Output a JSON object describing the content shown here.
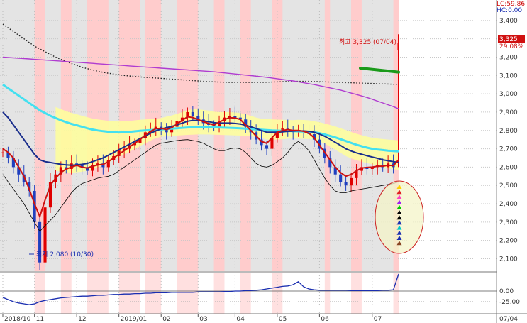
{
  "header": {
    "lc_label": "LC:59.86",
    "hc_label": "HC:0.00",
    "last_price": "3,325",
    "last_change": "29.08%"
  },
  "annotations": {
    "high": "최고 3,325 (07/04)",
    "low": "최저 2,080 (10/30)"
  },
  "colors": {
    "candle_up": "#e00000",
    "candle_down": "#1f3fbf",
    "ma_short": "#cc1111",
    "ma_mid": "#1a2e8c",
    "ma_cyan": "#44e0f0",
    "ma_black_dotted": "#222222",
    "ma_purple": "#b03cd0",
    "bollinger": "#000000",
    "cloud": "#ffff9a",
    "highlight_red": "#ffcccc",
    "shade_gray": "#e4e4e4",
    "indicator_line": "#1a2eb0",
    "ellipse": "#cc2222"
  },
  "chart_data": {
    "type": "line",
    "title": "",
    "xlabel": "",
    "ylabel": "",
    "ylim": [
      2040,
      3500
    ],
    "y_ticks": [
      "3,400",
      "3,300",
      "3,200",
      "3,100",
      "3,000",
      "2,900",
      "2,800",
      "2,700",
      "2,600",
      "2,500",
      "2,400",
      "2,300",
      "2,200",
      "2,100"
    ],
    "x_ticks": [
      "2018/10",
      "11",
      "12",
      "2019/01",
      "02",
      "03",
      "04",
      "05",
      "06",
      "07"
    ],
    "right_bottom_label": "07/04",
    "series": [
      {
        "name": "",
        "role": "close",
        "values": [
          2680,
          2650,
          2600,
          2560,
          2520,
          2470,
          2300,
          2080,
          2380,
          2520,
          2560,
          2600,
          2590,
          2620,
          2610,
          2600,
          2580,
          2610,
          2620,
          2600,
          2640,
          2660,
          2690,
          2700,
          2720,
          2730,
          2760,
          2790,
          2800,
          2820,
          2810,
          2790,
          2820,
          2850,
          2870,
          2900,
          2880,
          2860,
          2840,
          2830,
          2820,
          2850,
          2870,
          2880,
          2870,
          2860,
          2820,
          2790,
          2750,
          2720,
          2700,
          2760,
          2800,
          2810,
          2800,
          2790,
          2800,
          2790,
          2780,
          2750,
          2700,
          2650,
          2600,
          2560,
          2520,
          2500,
          2540,
          2580,
          2600,
          2590,
          2600,
          2610,
          2600,
          2620,
          2600,
          3325
        ]
      },
      {
        "name": "",
        "role": "ma_short",
        "values": [
          2700,
          2680,
          2650,
          2600,
          2550,
          2480,
          2400,
          2330,
          2420,
          2500,
          2540,
          2570,
          2590,
          2600,
          2610,
          2600,
          2595,
          2605,
          2612,
          2615,
          2630,
          2650,
          2670,
          2690,
          2710,
          2730,
          2750,
          2775,
          2795,
          2810,
          2812,
          2805,
          2815,
          2835,
          2855,
          2875,
          2870,
          2860,
          2848,
          2838,
          2830,
          2845,
          2860,
          2870,
          2868,
          2860,
          2830,
          2800,
          2770,
          2740,
          2730,
          2760,
          2790,
          2800,
          2805,
          2800,
          2800,
          2795,
          2785,
          2760,
          2720,
          2680,
          2640,
          2600,
          2570,
          2550,
          2560,
          2580,
          2595,
          2598,
          2600,
          2605,
          2605,
          2610,
          2608,
          2640
        ]
      },
      {
        "name": "",
        "role": "ma_mid",
        "values": [
          2900,
          2870,
          2830,
          2790,
          2750,
          2710,
          2670,
          2640,
          2630,
          2625,
          2620,
          2615,
          2612,
          2610,
          2612,
          2615,
          2620,
          2630,
          2640,
          2650,
          2665,
          2680,
          2695,
          2710,
          2725,
          2740,
          2755,
          2770,
          2785,
          2798,
          2808,
          2815,
          2822,
          2830,
          2840,
          2850,
          2855,
          2855,
          2852,
          2848,
          2842,
          2840,
          2840,
          2840,
          2838,
          2835,
          2828,
          2820,
          2810,
          2800,
          2790,
          2790,
          2790,
          2792,
          2795,
          2796,
          2798,
          2797,
          2795,
          2790,
          2780,
          2768,
          2752,
          2735,
          2718,
          2700,
          2688,
          2678,
          2670,
          2662,
          2655,
          2648,
          2640,
          2635,
          2630,
          2625
        ]
      },
      {
        "name": "",
        "role": "ma_cyan",
        "values": [
          3050,
          3030,
          3010,
          2990,
          2970,
          2950,
          2930,
          2910,
          2895,
          2880,
          2868,
          2856,
          2845,
          2836,
          2828,
          2820,
          2812,
          2805,
          2800,
          2796,
          2793,
          2790,
          2789,
          2790,
          2792,
          2795,
          2798,
          2800,
          2802,
          2804,
          2806,
          2808,
          2810,
          2812,
          2814,
          2816,
          2817,
          2818,
          2818,
          2818,
          2817,
          2816,
          2815,
          2814,
          2813,
          2812,
          2810,
          2808,
          2806,
          2804,
          2802,
          2800,
          2799,
          2798,
          2797,
          2796,
          2795,
          2794,
          2793,
          2790,
          2785,
          2778,
          2770,
          2762,
          2752,
          2742,
          2732,
          2722,
          2714,
          2706,
          2700,
          2696,
          2693,
          2690,
          2688,
          2686
        ]
      },
      {
        "name": "",
        "role": "ma_black_dotted",
        "values": [
          3380,
          3360,
          3340,
          3320,
          3300,
          3280,
          3260,
          3245,
          3230,
          3215,
          3200,
          3188,
          3176,
          3165,
          3155,
          3145,
          3137,
          3130,
          3123,
          3117,
          3112,
          3108,
          3104,
          3100,
          3097,
          3094,
          3092,
          3090,
          3088,
          3086,
          3084,
          3082,
          3080,
          3078,
          3076,
          3074,
          3072,
          3070,
          3068,
          3066,
          3065,
          3064,
          3063,
          3062,
          3062,
          3062,
          3062,
          3062,
          3062,
          3062,
          3063,
          3064,
          3065,
          3066,
          3067,
          3068,
          3068,
          3068,
          3068,
          3067,
          3066,
          3065,
          3064,
          3063,
          3062,
          3061,
          3060,
          3059,
          3058,
          3057,
          3056,
          3055,
          3054,
          3053,
          3052,
          3051
        ]
      },
      {
        "name": "",
        "role": "ma_purple",
        "values": [
          3200,
          3198,
          3196,
          3194,
          3192,
          3190,
          3188,
          3186,
          3184,
          3182,
          3180,
          3178,
          3176,
          3174,
          3172,
          3170,
          3168,
          3166,
          3164,
          3162,
          3160,
          3158,
          3156,
          3154,
          3152,
          3150,
          3148,
          3146,
          3144,
          3142,
          3140,
          3138,
          3136,
          3134,
          3132,
          3130,
          3128,
          3126,
          3124,
          3122,
          3120,
          3117,
          3114,
          3111,
          3108,
          3105,
          3102,
          3099,
          3096,
          3093,
          3090,
          3086,
          3082,
          3078,
          3074,
          3070,
          3065,
          3060,
          3055,
          3050,
          3044,
          3038,
          3032,
          3026,
          3020,
          3012,
          3004,
          2996,
          2988,
          2980,
          2970,
          2960,
          2950,
          2940,
          2930,
          2918
        ]
      },
      {
        "name": "",
        "role": "bollinger_lower",
        "values": [
          2560,
          2520,
          2480,
          2440,
          2400,
          2350,
          2300,
          2250,
          2280,
          2310,
          2340,
          2380,
          2420,
          2460,
          2490,
          2510,
          2520,
          2530,
          2540,
          2545,
          2550,
          2560,
          2580,
          2600,
          2620,
          2640,
          2660,
          2680,
          2700,
          2720,
          2730,
          2735,
          2740,
          2745,
          2748,
          2750,
          2745,
          2740,
          2730,
          2715,
          2700,
          2690,
          2690,
          2700,
          2705,
          2700,
          2680,
          2650,
          2620,
          2605,
          2600,
          2610,
          2630,
          2650,
          2680,
          2720,
          2740,
          2720,
          2690,
          2640,
          2590,
          2540,
          2500,
          2470,
          2460,
          2460,
          2470,
          2475,
          2480,
          2485,
          2490,
          2495,
          2500,
          2505,
          2510,
          2520
        ]
      },
      {
        "name": "",
        "role": "indicator",
        "values": [
          -15,
          -20,
          -25,
          -28,
          -30,
          -32,
          -30,
          -25,
          -22,
          -20,
          -18,
          -16,
          -15,
          -14,
          -13,
          -12,
          -12,
          -11,
          -10,
          -10,
          -9,
          -8,
          -8,
          -7,
          -7,
          -6,
          -6,
          -5,
          -5,
          -4,
          -4,
          -4,
          -3,
          -3,
          -3,
          -3,
          -3,
          -2,
          -2,
          -2,
          -2,
          -2,
          -1,
          -1,
          0,
          0,
          1,
          1,
          2,
          3,
          5,
          7,
          9,
          11,
          12,
          15,
          22,
          10,
          5,
          3,
          2,
          2,
          2,
          2,
          2,
          2,
          1,
          1,
          1,
          1,
          1,
          1,
          2,
          2,
          3,
          42
        ]
      }
    ],
    "indicator_ticks": [
      "0.00",
      "-25.00"
    ],
    "grid": true,
    "legend": "none"
  }
}
